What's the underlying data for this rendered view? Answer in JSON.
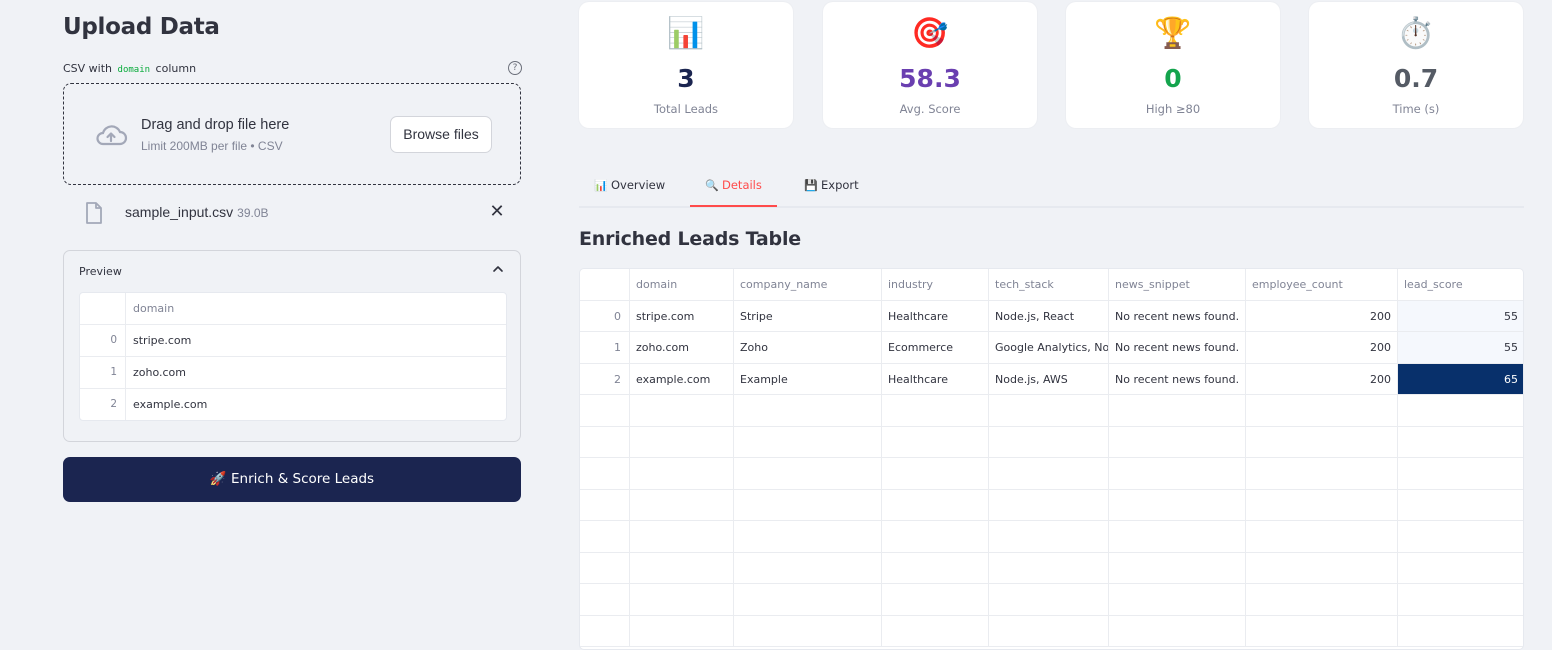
{
  "upload": {
    "title": "Upload Data",
    "csv_prefix": "CSV with",
    "csv_code": "domain",
    "csv_suffix": "column",
    "help": "?",
    "dropzone_main": "Drag and drop file here",
    "dropzone_sub": "Limit 200MB per file • CSV",
    "browse_label": "Browse files",
    "file_name": "sample_input.csv",
    "file_size": "39.0B",
    "close": "✕",
    "preview_label": "Preview",
    "preview_header": "domain",
    "preview_rows": [
      {
        "idx": "0",
        "domain": "stripe.com"
      },
      {
        "idx": "1",
        "domain": "zoho.com"
      },
      {
        "idx": "2",
        "domain": "example.com"
      }
    ],
    "enrich_icon": "🚀",
    "enrich_label": "Enrich & Score Leads"
  },
  "metrics": [
    {
      "icon": "📊",
      "icon_name": "bar-chart-icon",
      "value": "3",
      "label": "Total Leads",
      "color": "#1b2550"
    },
    {
      "icon": "🎯",
      "icon_name": "target-icon",
      "value": "58.3",
      "label": "Avg. Score",
      "color": "#6a3fb0"
    },
    {
      "icon": "🏆",
      "icon_name": "trophy-icon",
      "value": "0",
      "label": "High ≥80",
      "color": "#14a44d"
    },
    {
      "icon": "⏱️",
      "icon_name": "stopwatch-icon",
      "value": "0.7",
      "label": "Time (s)",
      "color": "#555b65"
    }
  ],
  "tabs": [
    {
      "icon": "📊",
      "label": "Overview"
    },
    {
      "icon": "🔍",
      "label": "Details",
      "active": true
    },
    {
      "icon": "💾",
      "label": "Export"
    }
  ],
  "table": {
    "title": "Enriched Leads Table",
    "columns": [
      "domain",
      "company_name",
      "industry",
      "tech_stack",
      "news_snippet",
      "employee_count",
      "lead_score"
    ],
    "rows": [
      {
        "idx": "0",
        "domain": "stripe.com",
        "company_name": "Stripe",
        "industry": "Healthcare",
        "tech_stack": "Node.js, React",
        "news_snippet": "No recent news found.",
        "employee_count": "200",
        "lead_score": "55"
      },
      {
        "idx": "1",
        "domain": "zoho.com",
        "company_name": "Zoho",
        "industry": "Ecommerce",
        "tech_stack": "Google Analytics, Node.js",
        "news_snippet": "No recent news found.",
        "employee_count": "200",
        "lead_score": "55"
      },
      {
        "idx": "2",
        "domain": "example.com",
        "company_name": "Example",
        "industry": "Healthcare",
        "tech_stack": "Node.js, AWS",
        "news_snippet": "No recent news found.",
        "employee_count": "200",
        "lead_score": "65"
      }
    ]
  }
}
